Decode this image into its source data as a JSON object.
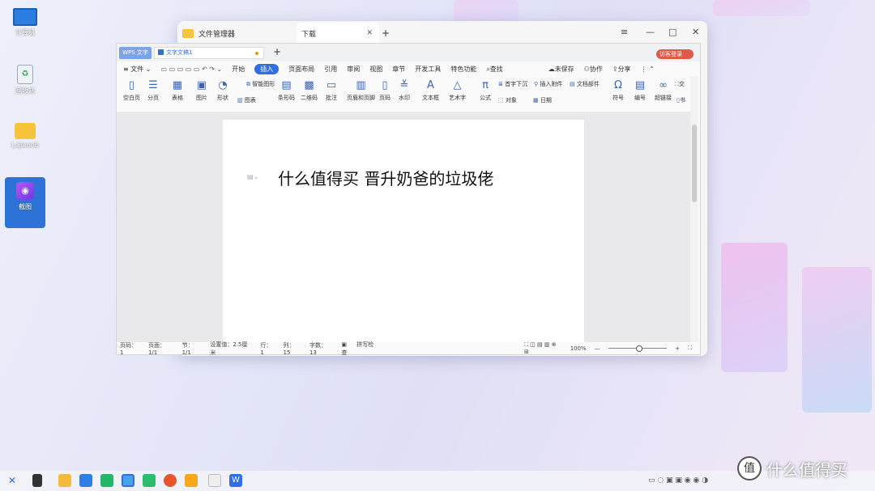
{
  "desktop": {
    "icons": [
      {
        "label": "计算机"
      },
      {
        "label": "回收站"
      },
      {
        "label": "Lajiaonb"
      },
      {
        "label": "截图"
      }
    ]
  },
  "file_manager": {
    "title": "文件管理器",
    "tab": "下载",
    "new_tab": "+",
    "menu_icon": "≡",
    "min_icon": "—",
    "max_icon": "□",
    "close_icon": "✕"
  },
  "wps": {
    "app_tab": "WPS 文字",
    "doc_tab": "文字文稿1",
    "add_tab": "+",
    "guest_login": "访客登录",
    "file_menu": "文件",
    "menu": [
      "开始",
      "插入",
      "页面布局",
      "引用",
      "审阅",
      "视图",
      "章节",
      "开发工具",
      "特色功能"
    ],
    "search": "查找",
    "unsaved": "未保存",
    "collab": "协作",
    "share": "分享",
    "tools": [
      {
        "label": "空白页",
        "icon": "▯"
      },
      {
        "label": "分页",
        "icon": "☰"
      },
      {
        "label": "表格",
        "icon": "▦"
      },
      {
        "label": "图片",
        "icon": "▣"
      },
      {
        "label": "形状",
        "icon": "◔"
      },
      {
        "label": "条形码",
        "icon": "▤"
      },
      {
        "label": "二维码",
        "icon": "▩"
      },
      {
        "label": "批注",
        "icon": "▭"
      },
      {
        "label": "页眉和页脚",
        "icon": "▥"
      },
      {
        "label": "页码",
        "icon": "▯"
      },
      {
        "label": "水印",
        "icon": "≚"
      },
      {
        "label": "文本框",
        "icon": "A"
      },
      {
        "label": "艺术字",
        "icon": "△"
      },
      {
        "label": "公式",
        "icon": "π"
      },
      {
        "label": "符号",
        "icon": "Ω"
      },
      {
        "label": "编号",
        "icon": "▤"
      },
      {
        "label": "超链接",
        "icon": "∞"
      }
    ],
    "smart_shape": "智能图形",
    "chart": "图表",
    "drop_cap": "首字下沉",
    "attachment": "插入附件",
    "doc_parts": "文档部件",
    "object": "对象",
    "date": "日期",
    "more_1": "交",
    "more_2": "书",
    "document_text": "什么值得买 晋升奶爸的垃圾佬",
    "status": {
      "page": "页码：1",
      "pages": "页面：1/1",
      "section": "节：1/1",
      "setting": "设置值：2.5厘米",
      "row": "行：1",
      "col": "列：15",
      "chars": "字数：13",
      "spell": "拼写检查",
      "zoom": "100%",
      "zoom_minus": "—",
      "zoom_plus": "+"
    }
  },
  "watermark": "什么值得买"
}
